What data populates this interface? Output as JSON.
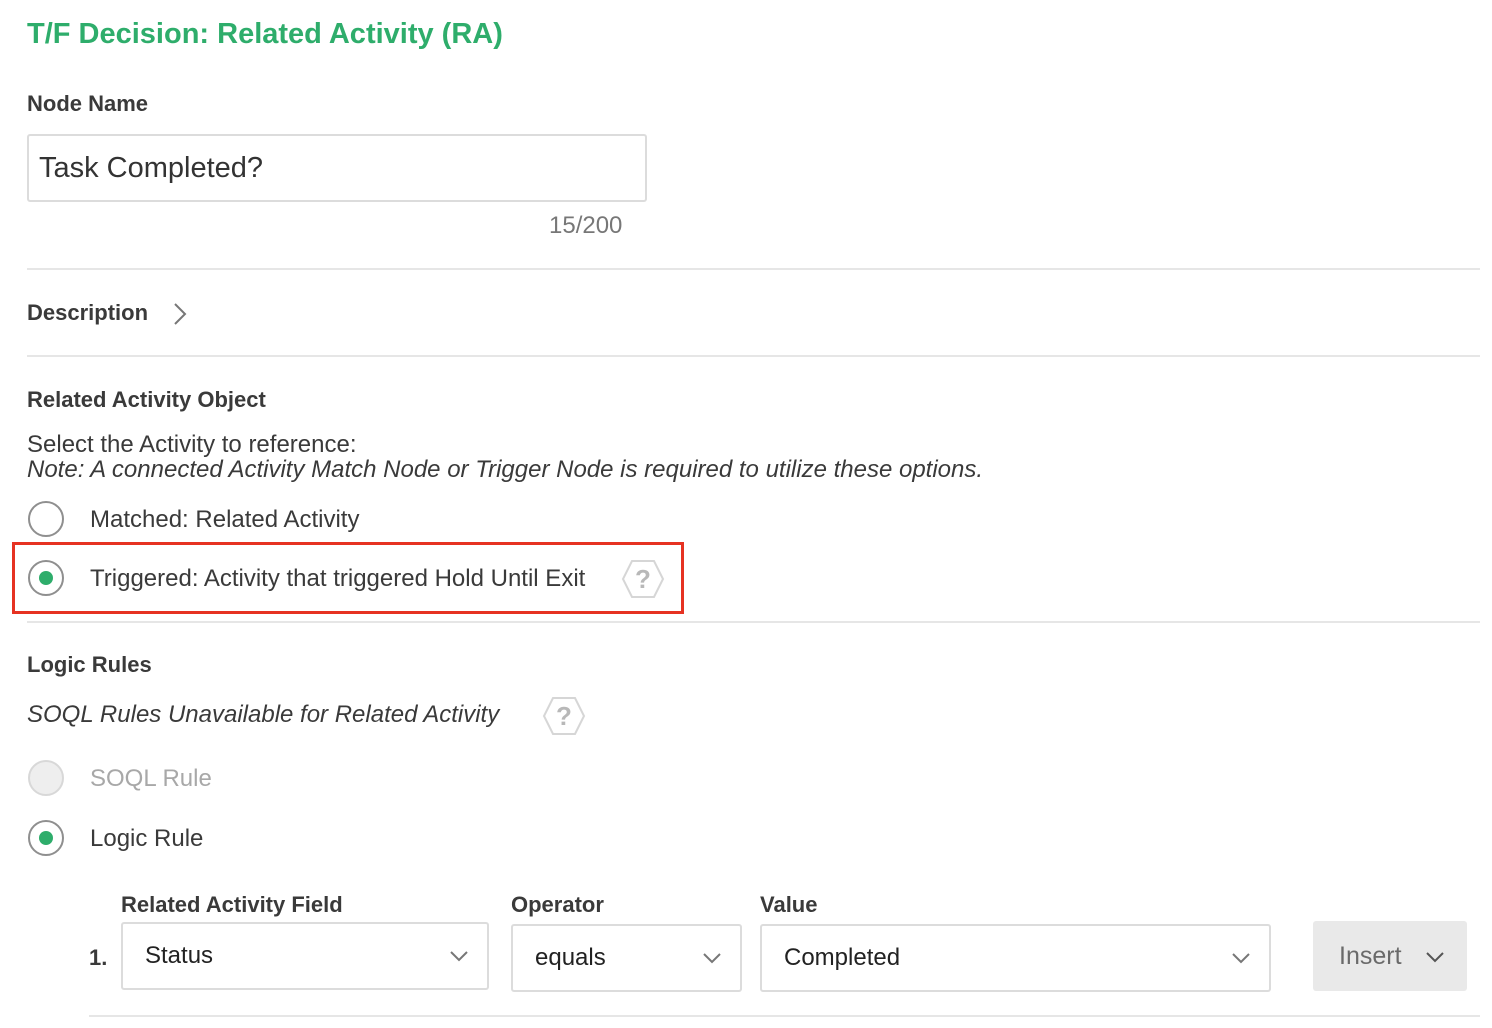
{
  "panel": {
    "title": "T/F Decision: Related Activity (RA)"
  },
  "node_name": {
    "label": "Node Name",
    "value": "Task Completed?",
    "counter": "15/200"
  },
  "description": {
    "label": "Description"
  },
  "related_activity_object": {
    "heading": "Related Activity Object",
    "instruction": "Select the Activity to reference:",
    "note": "Note: A connected Activity Match Node or Trigger Node is required to utilize these options.",
    "options": [
      {
        "label": "Matched: Related Activity",
        "selected": false
      },
      {
        "label": "Triggered: Activity that triggered Hold Until Exit",
        "selected": true
      }
    ]
  },
  "logic_rules": {
    "heading": "Logic Rules",
    "soql_notice": "SOQL Rules Unavailable for Related Activity",
    "options": [
      {
        "label": "SOQL Rule",
        "selected": false,
        "disabled": true
      },
      {
        "label": "Logic Rule",
        "selected": true,
        "disabled": false
      }
    ],
    "columns": {
      "field": "Related Activity Field",
      "operator": "Operator",
      "value": "Value"
    },
    "rules": [
      {
        "index": "1.",
        "field": "Status",
        "operator": "equals",
        "value": "Completed"
      }
    ],
    "insert_label": "Insert"
  },
  "colors": {
    "accent": "#2ead6b",
    "highlight": "#e63222"
  },
  "icons": [
    "chevron-right-icon",
    "help-icon",
    "chevron-down-icon"
  ]
}
